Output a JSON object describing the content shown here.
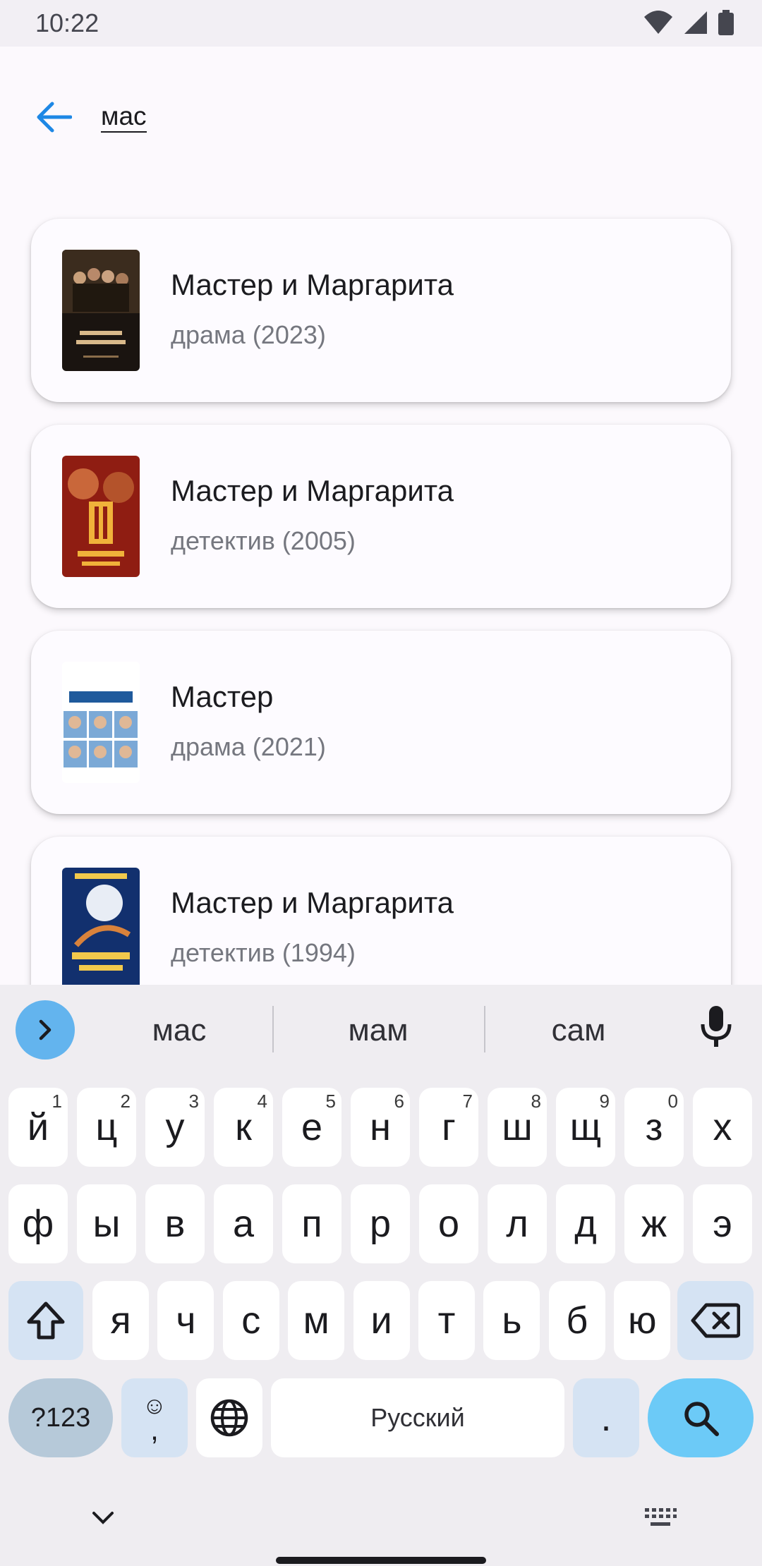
{
  "status_bar": {
    "time": "10:22"
  },
  "search": {
    "query": "мас"
  },
  "results": [
    {
      "title": "Мастер и Маргарита",
      "subtitle": "драма (2023)",
      "poster": "poster-dark-ensemble"
    },
    {
      "title": "Мастер и Маргарита",
      "subtitle": "детектив (2005)",
      "poster": "poster-red-couple"
    },
    {
      "title": "Мастер",
      "subtitle": "драма (2021)",
      "poster": "poster-team-grid"
    },
    {
      "title": "Мастер и Маргарита",
      "subtitle": "детектив (1994)",
      "poster": "poster-blue-witch"
    }
  ],
  "keyboard": {
    "suggestions": [
      "мас",
      "мам",
      "сам"
    ],
    "row1": [
      {
        "k": "й",
        "h": "1"
      },
      {
        "k": "ц",
        "h": "2"
      },
      {
        "k": "у",
        "h": "3"
      },
      {
        "k": "к",
        "h": "4"
      },
      {
        "k": "е",
        "h": "5"
      },
      {
        "k": "н",
        "h": "6"
      },
      {
        "k": "г",
        "h": "7"
      },
      {
        "k": "ш",
        "h": "8"
      },
      {
        "k": "щ",
        "h": "9"
      },
      {
        "k": "з",
        "h": "0"
      },
      {
        "k": "х",
        "h": ""
      }
    ],
    "row2": [
      "ф",
      "ы",
      "в",
      "а",
      "п",
      "р",
      "о",
      "л",
      "д",
      "ж",
      "э"
    ],
    "row3": [
      "я",
      "ч",
      "с",
      "м",
      "и",
      "т",
      "ь",
      "б",
      "ю"
    ],
    "symbols_label": "?123",
    "emoji_label": "☺",
    "comma_label": ",",
    "space_label": "Русский",
    "period_label": "."
  }
}
